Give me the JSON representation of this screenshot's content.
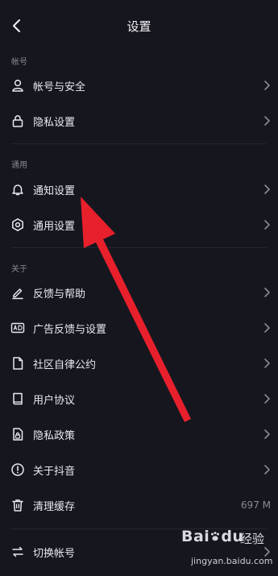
{
  "header": {
    "title": "设置",
    "back_icon": "chevron-left-icon"
  },
  "sections": [
    {
      "label": "帐号",
      "items": [
        {
          "label": "帐号与安全",
          "icon": "user-icon"
        },
        {
          "label": "隐私设置",
          "icon": "lock-icon"
        }
      ]
    },
    {
      "label": "通用",
      "items": [
        {
          "label": "通知设置",
          "icon": "bell-icon"
        },
        {
          "label": "通用设置",
          "icon": "gear-icon"
        }
      ]
    },
    {
      "label": "关于",
      "items": [
        {
          "label": "反馈与帮助",
          "icon": "edit-icon"
        },
        {
          "label": "广告反馈与设置",
          "icon": "ad-icon"
        },
        {
          "label": "社区自律公约",
          "icon": "document-icon"
        },
        {
          "label": "用户协议",
          "icon": "book-icon"
        },
        {
          "label": "隐私政策",
          "icon": "privacy-doc-icon"
        },
        {
          "label": "关于抖音",
          "icon": "info-icon"
        },
        {
          "label": "清理缓存",
          "icon": "trash-icon",
          "value": "697 M"
        }
      ]
    }
  ],
  "switch_account": {
    "label": "切换帐号",
    "icon": "switch-icon"
  },
  "watermark": {
    "brand": "Bai",
    "paw": "du",
    "suffix": "经验",
    "domain": "jingyan.baidu.com"
  },
  "colors": {
    "background": "#16161f",
    "text": "#e9e9ef",
    "muted": "#8a8a95",
    "arrow": "#e8202c"
  }
}
